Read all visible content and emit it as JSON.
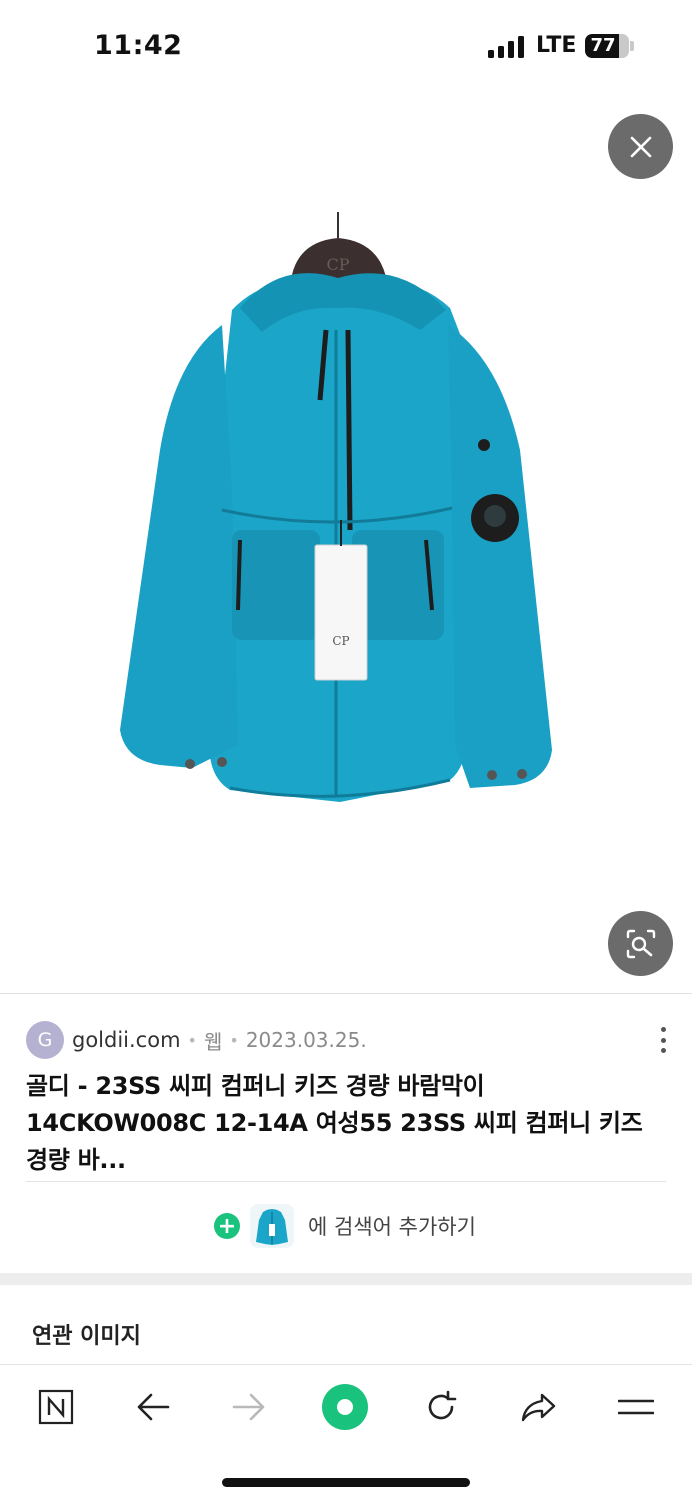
{
  "status_bar": {
    "time": "11:42",
    "network": "LTE",
    "battery_level": "77",
    "battery_percent": 77
  },
  "icons": {
    "close": "close-icon",
    "lens": "image-search-icon",
    "more": "more-vertical-icon",
    "plus": "plus-circle-icon"
  },
  "result": {
    "favicon_letter": "G",
    "domain": "goldii.com",
    "type": "웹",
    "date": "2023.03.25.",
    "title": "골디 - 23SS 씨피 컴퍼니 키즈 경량 바람막이 14CKOW008C 12-14A 여성55 23SS 씨피 컴퍼니 키즈 경량 바..."
  },
  "add_search": {
    "label": "에 검색어 추가하기"
  },
  "related": {
    "title": "연관 이미지"
  },
  "bottom_nav": {
    "items": [
      "naver-home-icon",
      "back-arrow-icon",
      "forward-arrow-icon",
      "green-dot-icon",
      "reload-icon",
      "share-icon",
      "menu-icon"
    ]
  },
  "colors": {
    "accent_green": "#19c37d",
    "jacket_blue": "#1aa5c9"
  }
}
